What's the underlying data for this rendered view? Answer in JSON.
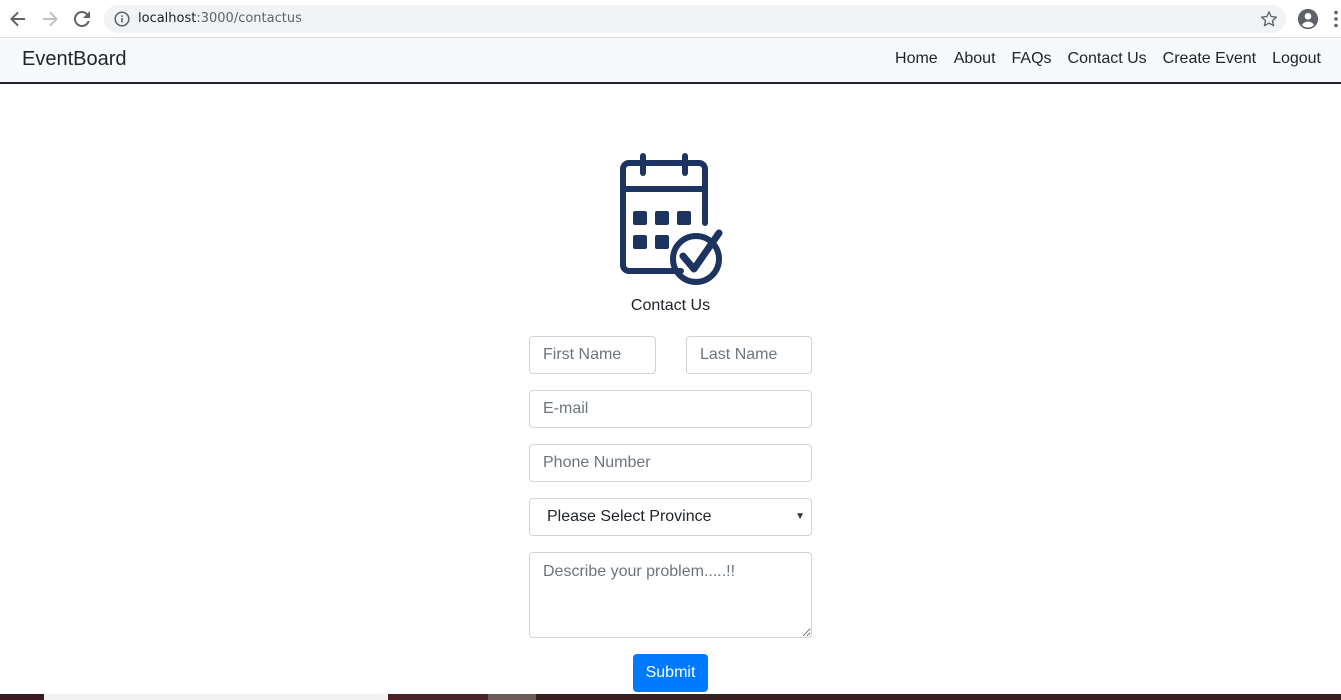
{
  "browser": {
    "url_host": "localhost",
    "url_path": ":3000/contactus"
  },
  "navbar": {
    "brand": "EventBoard",
    "links": [
      "Home",
      "About",
      "FAQs",
      "Contact Us",
      "Create Event",
      "Logout"
    ]
  },
  "form": {
    "heading": "Contact Us",
    "first_name_placeholder": "First Name",
    "last_name_placeholder": "Last Name",
    "email_placeholder": "E-mail",
    "phone_placeholder": "Phone Number",
    "province_selected": "Please Select Province",
    "problem_placeholder": "Describe your problem.....!!",
    "submit_label": "Submit"
  },
  "colors": {
    "accent": "#007bff",
    "logo": "#1d3461"
  },
  "icons": [
    "back-arrow-icon",
    "forward-arrow-icon",
    "reload-icon",
    "info-icon",
    "star-icon",
    "profile-icon",
    "menu-icon",
    "calendar-check-icon"
  ]
}
